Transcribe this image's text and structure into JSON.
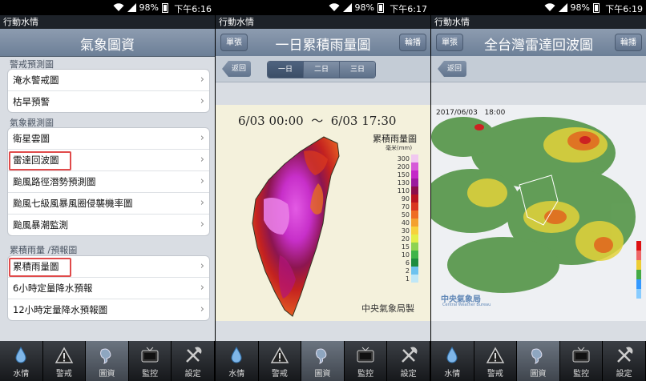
{
  "status": [
    {
      "battery": "98%",
      "time": "下午6:16"
    },
    {
      "battery": "98%",
      "time": "下午6:17"
    },
    {
      "battery": "98%",
      "time": "下午6:19"
    }
  ],
  "app_title": "行動水情",
  "panel1": {
    "title": "氣象圖資",
    "sections": [
      {
        "label": "警戒預測圖",
        "items": [
          "淹水警戒圖",
          "枯旱預警"
        ]
      },
      {
        "label": "氣象觀測圖",
        "items": [
          "衛星雲圖",
          "雷達回波圖",
          "颱風路徑潛勢預測圖",
          "颱風七級風暴風圈侵襲機率圖",
          "颱風暴潮監測"
        ]
      },
      {
        "label": "累積雨量 /預報圖",
        "items": [
          "累積雨量圖",
          "6小時定量降水預報",
          "12小時定量降水預報圖"
        ]
      }
    ]
  },
  "panel2": {
    "title": "一日累積雨量圖",
    "left_button": "單張",
    "right_button": "輪播",
    "back_button": "返回",
    "segments": [
      "一日",
      "二日",
      "三日"
    ],
    "map": {
      "date_range": "6/03 00:00  ～  6/03 17:30",
      "legend_title": "累積雨量圖",
      "legend_unit": "毫米(mm)",
      "legend_values": [
        "300",
        "200",
        "150",
        "130",
        "110",
        "90",
        "70",
        "50",
        "40",
        "30",
        "20",
        "15",
        "10",
        "6",
        "2",
        "1"
      ],
      "legend_colors": [
        "#f1c8f0",
        "#d65ad8",
        "#c428c8",
        "#9b1b9e",
        "#8c0f4a",
        "#b8141f",
        "#d9371f",
        "#ef6d22",
        "#f4a12e",
        "#f7d23c",
        "#e4ef48",
        "#8ed351",
        "#3fb449",
        "#1d8c3f",
        "#6ec3ef",
        "#bfe7f7"
      ],
      "credit": "中央氣象局製"
    }
  },
  "panel3": {
    "title": "全台灣雷達回波圖",
    "left_button": "單張",
    "right_button": "輪播",
    "back_button": "返回",
    "radar": {
      "timestamp": "2017/06/03   18:00",
      "credit_main": "中央氣象局",
      "credit_sub": "Central Weather Bureau"
    }
  },
  "tabs": [
    "水情",
    "警戒",
    "圖資",
    "監控",
    "設定"
  ],
  "tab_icons": [
    "water-drop-icon",
    "warning-icon",
    "map-icon",
    "tv-monitor-icon",
    "tools-icon"
  ]
}
